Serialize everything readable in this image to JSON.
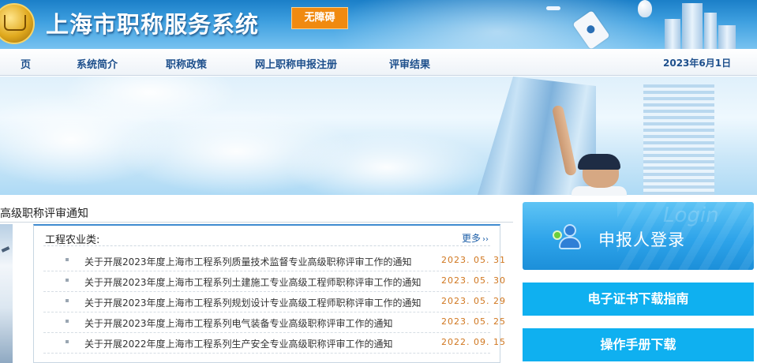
{
  "header": {
    "site_title": "上海市职称服务系统",
    "accessibility_label": "无障碍"
  },
  "nav": {
    "items": [
      {
        "label": "页"
      },
      {
        "label": "系统简介"
      },
      {
        "label": "职称政策"
      },
      {
        "label": "网上职称申报注册"
      },
      {
        "label": "评审结果"
      }
    ],
    "date": "2023年6月1日"
  },
  "section": {
    "title": "高级职称评审通知"
  },
  "panel": {
    "title": "工程农业类:",
    "more_label": "更多",
    "more_arrows": "››",
    "items": [
      {
        "title": "关于开展2023年度上海市工程系列质量技术监督专业高级职称评审工作的通知",
        "date": "2023. 05. 31"
      },
      {
        "title": "关于开展2023年度上海市工程系列土建施工专业高级工程师职称评审工作的通知",
        "date": "2023. 05. 30"
      },
      {
        "title": "关于开展2023年度上海市工程系列规划设计专业高级工程师职称评审工作的通知",
        "date": "2023. 05. 29"
      },
      {
        "title": "关于开展2023年度上海市工程系列电气装备专业高级职称评审工作的通知",
        "date": "2023. 05. 25"
      },
      {
        "title": "关于开展2022年度上海市工程系列生产安全专业高级职称评审工作的通知",
        "date": "2022. 09. 15"
      }
    ]
  },
  "sidebar": {
    "login_ghost": "Login",
    "login_label": "申报人登录",
    "cert_guide_label": "电子证书下载指南",
    "manual_label": "操作手册下载"
  },
  "colors": {
    "header_blue": "#1b7fc8",
    "nav_text": "#1d4f8c",
    "access_orange": "#f08a10",
    "date_orange": "#d0761e",
    "side_button": "#0fb0f0"
  },
  "icons": [
    "logo-emblem-icon",
    "airplane-icon",
    "balloon-icon",
    "diploma-scroll-icon",
    "users-icon",
    "list-bullet-icon",
    "double-chevron-right-icon"
  ]
}
